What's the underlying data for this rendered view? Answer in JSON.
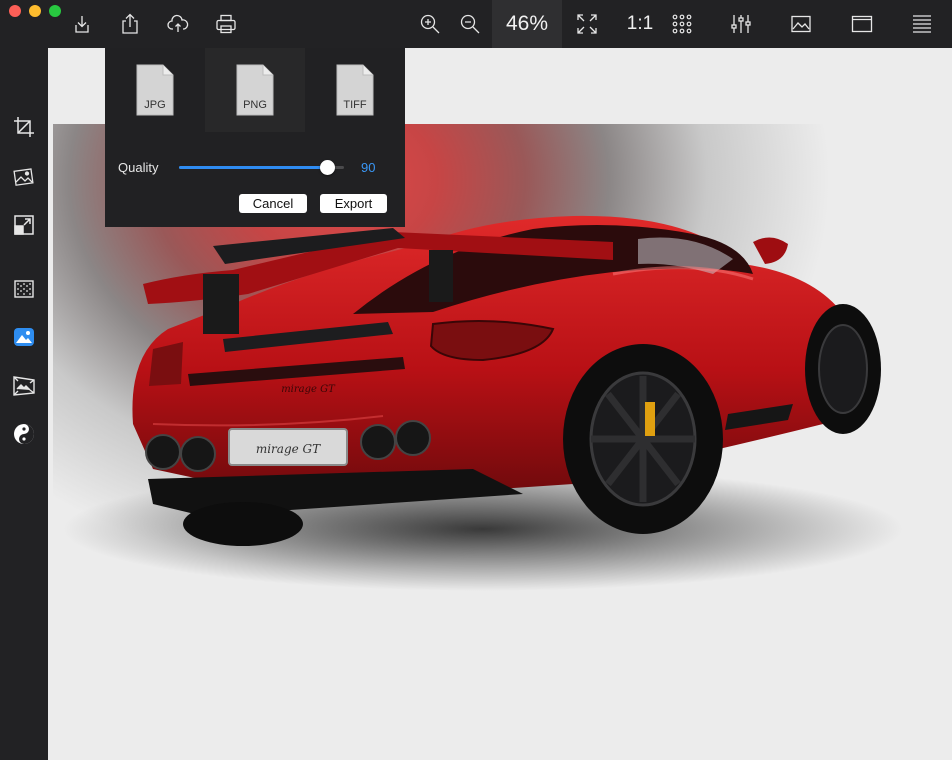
{
  "toolbar": {
    "zoom_level": "46%",
    "actual_size_label": "1:1",
    "icons": [
      "import-icon",
      "share-icon",
      "cloud-upload-icon",
      "print-icon",
      "zoom-in-icon",
      "zoom-out-icon",
      "fit-to-window-icon",
      "grid-icon",
      "adjustments-icon",
      "image-icon",
      "window-icon",
      "menu-icon"
    ]
  },
  "sidebar": {
    "tools": [
      "crop-icon",
      "image-edit-icon",
      "resize-icon",
      "noise-icon",
      "enhance-icon",
      "perspective-icon",
      "yin-yang-icon"
    ]
  },
  "export_panel": {
    "formats": [
      {
        "label": "JPG",
        "selected": false
      },
      {
        "label": "PNG",
        "selected": true
      },
      {
        "label": "TIFF",
        "selected": false
      }
    ],
    "quality_label": "Quality",
    "quality_value": "90",
    "quality_fraction": 0.9,
    "cancel_label": "Cancel",
    "export_label": "Export"
  },
  "photo": {
    "plate_text": "mirage GT",
    "badge_text": "mirage GT"
  },
  "colors": {
    "toolbar_bg": "#222224",
    "accent": "#3a97f5",
    "canvas_bg": "#ececec",
    "car_red": "#c8141a"
  }
}
